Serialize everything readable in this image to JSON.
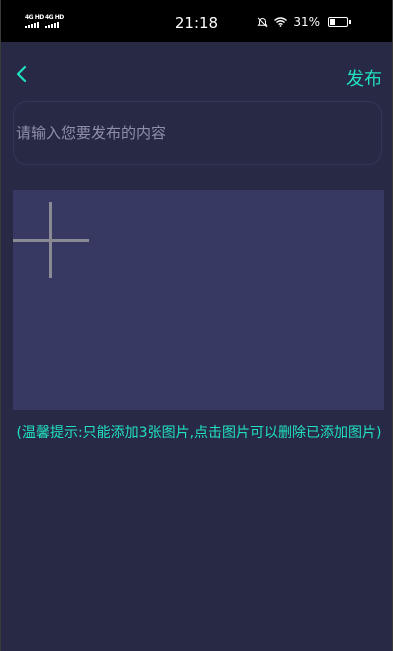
{
  "status_bar": {
    "signal1": "4G HD",
    "signal2": "4G HD",
    "time": "21:18",
    "battery_percent": "31%",
    "battery_level": 0.31
  },
  "header": {
    "back_icon": "chevron-left-icon",
    "publish_label": "发布"
  },
  "content": {
    "placeholder": "请输入您要发布的内容",
    "value": ""
  },
  "images": {
    "add_icon": "plus-icon",
    "tip": "(温馨提示:只能添加3张图片,点击图片可以删除已添加图片)"
  },
  "colors": {
    "accent": "#20e0bf",
    "background": "#282a45",
    "image_area": "#373963"
  }
}
